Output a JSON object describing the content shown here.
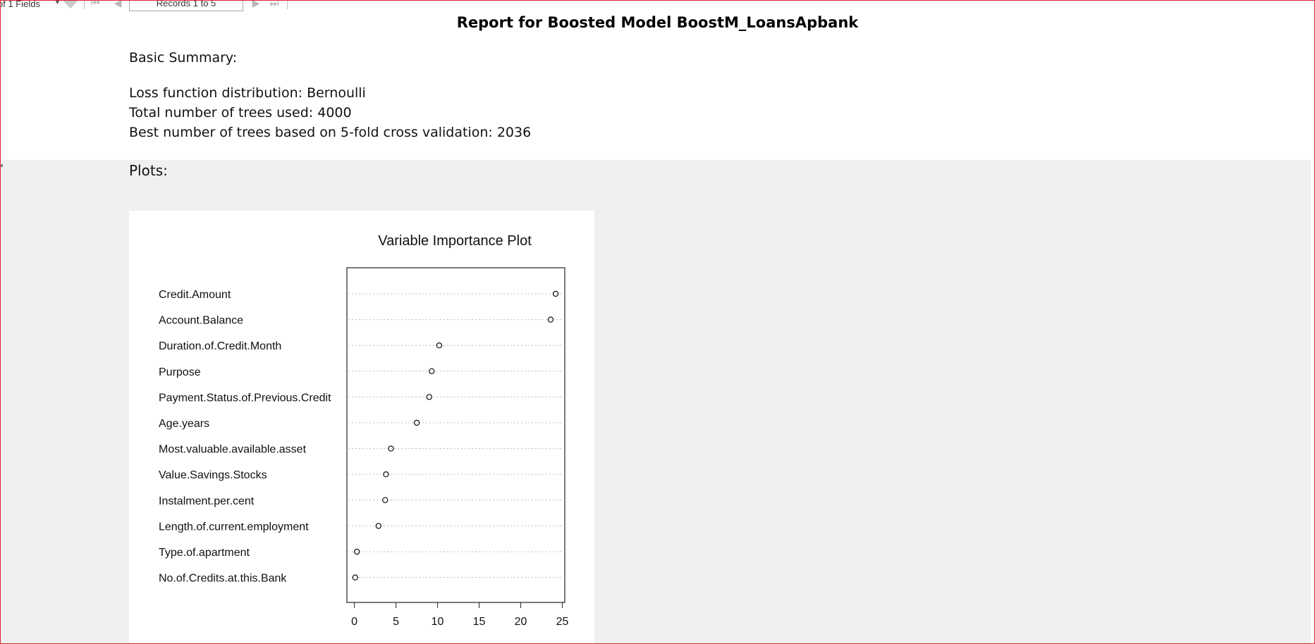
{
  "toolbar": {
    "fields_label": "of 1 Fields",
    "records_label": "Records 1 to 5"
  },
  "report": {
    "title": "Report for Boosted Model BoostM_LoansApbank",
    "basic_summary_label": "Basic Summary:",
    "loss_line": "Loss function distribution: Bernoulli",
    "trees_line": "Total number of trees used: 4000",
    "best_line": "Best number of trees based on 5-fold cross validation: 2036",
    "plots_label": "Plots:"
  },
  "chart_data": {
    "type": "scatter",
    "title": "Variable Importance Plot",
    "categories": [
      "Credit.Amount",
      "Account.Balance",
      "Duration.of.Credit.Month",
      "Purpose",
      "Payment.Status.of.Previous.Credit",
      "Age.years",
      "Most.valuable.available.asset",
      "Value.Savings.Stocks",
      "Instalment.per.cent",
      "Length.of.current.employment",
      "Type.of.apartment",
      "No.of.Credits.at.this.Bank"
    ],
    "values": [
      24.2,
      23.6,
      10.2,
      9.3,
      9.0,
      7.5,
      4.4,
      3.8,
      3.7,
      2.9,
      0.3,
      0.1
    ],
    "xlim": [
      -0.9,
      25.3
    ],
    "xticks": [
      "0",
      "5",
      "10",
      "15",
      "20",
      "25"
    ],
    "xtick_values": [
      0,
      5,
      10,
      15,
      20,
      25
    ],
    "grid": "dotted horizontal guide lines",
    "marker": "open circle"
  }
}
